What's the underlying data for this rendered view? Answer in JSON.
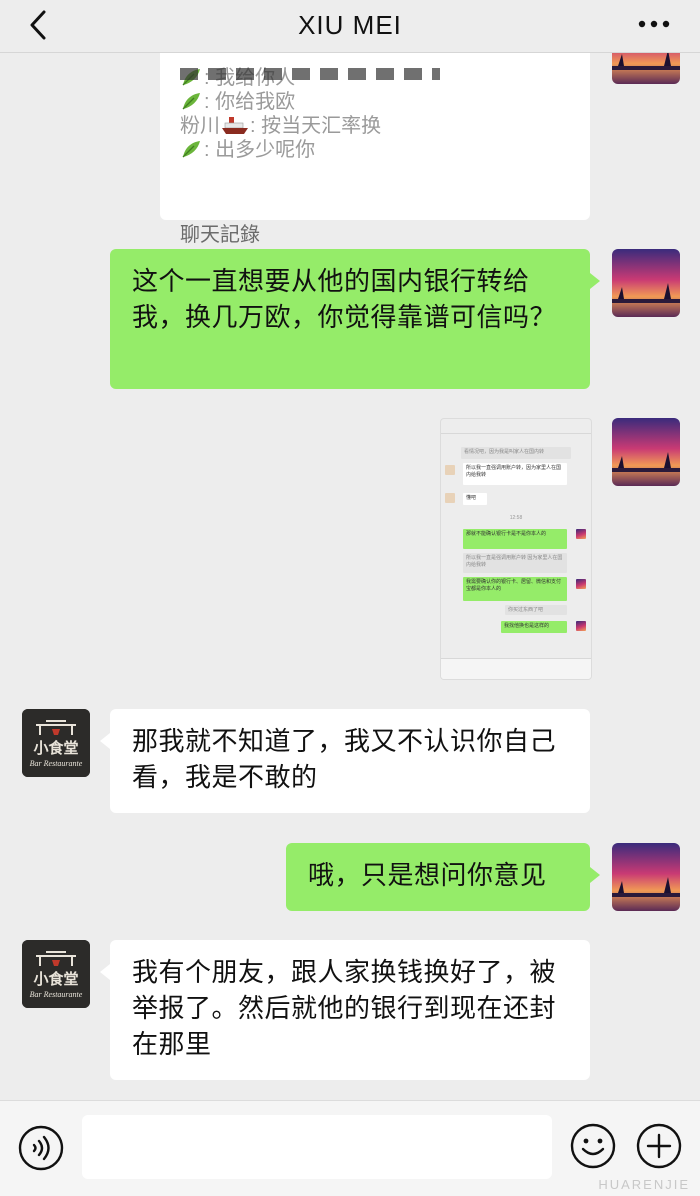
{
  "header": {
    "title": "XIU MEI",
    "back_icon": "chevron-left-icon",
    "more_icon": "ellipsis-icon"
  },
  "quoted_card": {
    "lines": [
      {
        "sender_icon": "leaf-icon",
        "text": ": 我给你人"
      },
      {
        "sender_icon": "leaf-icon",
        "text": ": 你给我欧"
      },
      {
        "sender": "粉川",
        "sender_icon": "ship-icon",
        "text": ": 按当天汇率换"
      },
      {
        "sender_icon": "leaf-icon",
        "text": ": 出多少呢你"
      }
    ],
    "footer": "聊天記錄"
  },
  "messages": [
    {
      "side": "me",
      "text": "这个一直想要从他的国内银行转给我，换几万欧，你觉得靠谱可信吗？"
    },
    {
      "side": "me",
      "type": "image",
      "thumbnail": {
        "bubbles": [
          {
            "style": "quote",
            "text": "看情况吧，因为我是叫家人在国内转"
          },
          {
            "style": "white",
            "text": "所以我一直强调用账户转，因为家里人在国内给我转"
          },
          {
            "style": "white",
            "text": "懂吧"
          },
          {
            "style": "time",
            "text": "12:58"
          },
          {
            "style": "green",
            "text": "那就不能确认银行卡是不是你本人的"
          },
          {
            "style": "quote",
            "text": "所以我一直是强调用账户转 因为家里人在国内给我转"
          },
          {
            "style": "green",
            "text": "我需要确认你的银行卡、居留、微信和支付宝都是你本人的"
          },
          {
            "style": "quote",
            "text": "你买过东西了吧"
          },
          {
            "style": "green",
            "text": "我找他换也是这样的"
          }
        ]
      }
    },
    {
      "side": "them",
      "text": "那我就不知道了，我又不认识你自己看，我是不敢的"
    },
    {
      "side": "me",
      "text": "哦，只是想问你意见"
    },
    {
      "side": "them",
      "text": "我有个朋友，跟人家换钱换好了，被举报了。然后就他的银行到现在还封在那里"
    }
  ],
  "avatars": {
    "me": "sunset-photo",
    "them_text_top": "小食堂",
    "them_text_bottom": "Bar Restaurante"
  },
  "input_bar": {
    "voice_icon": "voice-icon",
    "placeholder": "",
    "emoji_icon": "emoji-icon",
    "plus_icon": "plus-icon"
  },
  "watermark": "HUARENJIE"
}
